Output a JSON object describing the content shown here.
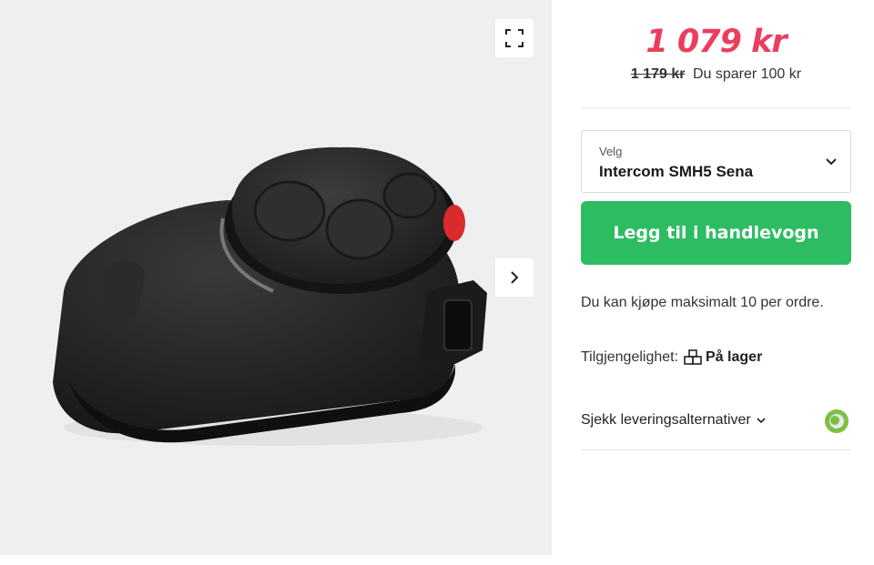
{
  "gallery": {
    "image_alt": "Intercom SMH5 Sena",
    "fullscreen_icon": "expand-icon",
    "next_icon": "chevron-right-icon"
  },
  "product": {
    "price": "1 079 kr",
    "old_price": "1 179 kr",
    "savings": "Du sparer 100 kr",
    "variant_label": "Velg",
    "variant_value": "Intercom SMH5 Sena",
    "add_to_cart": "Legg til i handlevogn",
    "max_note": "Du kan kjøpe maksimalt 10 per ordre.",
    "availability_label": "Tilgjengelighet:",
    "availability_value": "På lager",
    "delivery_link": "Sjekk leveringsalternativer"
  },
  "colors": {
    "price": "#ec3d5e",
    "cta": "#2ebc63",
    "gallery_bg": "#efefef"
  }
}
